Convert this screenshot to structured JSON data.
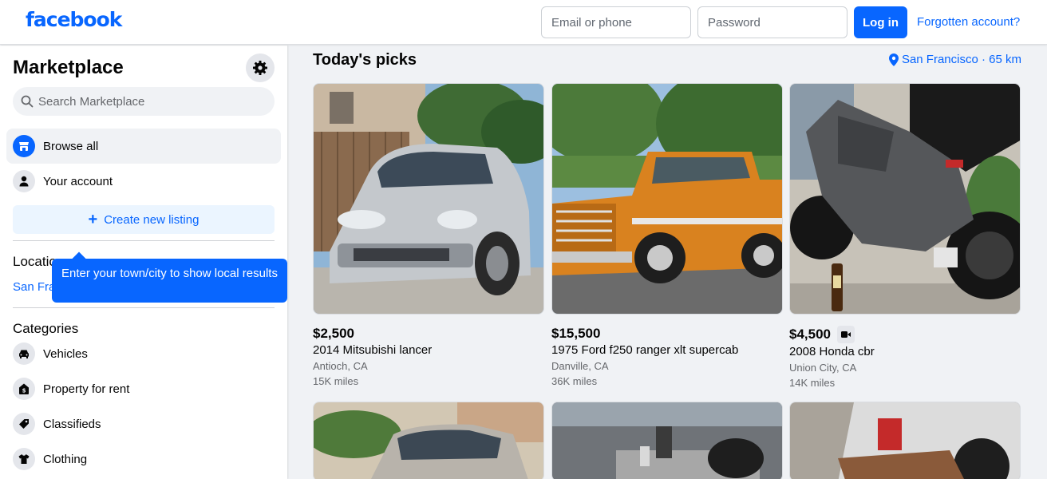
{
  "header": {
    "logo": "facebook",
    "email_placeholder": "Email or phone",
    "password_placeholder": "Password",
    "login_label": "Log in",
    "forgot_label": "Forgotten account?"
  },
  "sidebar": {
    "title": "Marketplace",
    "search_placeholder": "Search Marketplace",
    "nav": [
      {
        "label": "Browse all",
        "icon": "shop-icon",
        "active": true
      },
      {
        "label": "Your account",
        "icon": "person-icon",
        "active": false
      }
    ],
    "create_label": "Create new listing",
    "location_heading": "Location",
    "location_value": "San Francisco, California",
    "tooltip": "Enter your town/city to show local results",
    "categories_heading": "Categories",
    "categories": [
      {
        "label": "Vehicles",
        "icon": "car-icon"
      },
      {
        "label": "Property for rent",
        "icon": "house-icon"
      },
      {
        "label": "Classifieds",
        "icon": "tag-icon"
      },
      {
        "label": "Clothing",
        "icon": "shirt-icon"
      }
    ]
  },
  "main": {
    "heading": "Today's picks",
    "location_label": "San Francisco · 65 km",
    "listings": [
      {
        "price": "$2,500",
        "title": "2014 Mitsubishi lancer",
        "location": "Antioch, CA",
        "miles": "15K miles",
        "video": false
      },
      {
        "price": "$15,500",
        "title": "1975 Ford f250 ranger xlt supercab",
        "location": "Danville, CA",
        "miles": "36K miles",
        "video": false
      },
      {
        "price": "$4,500",
        "title": "2008 Honda cbr",
        "location": "Union City, CA",
        "miles": "14K miles",
        "video": true
      }
    ]
  },
  "colors": {
    "brand": "#0866ff",
    "background": "#f0f2f5",
    "text_secondary": "#65676b"
  }
}
